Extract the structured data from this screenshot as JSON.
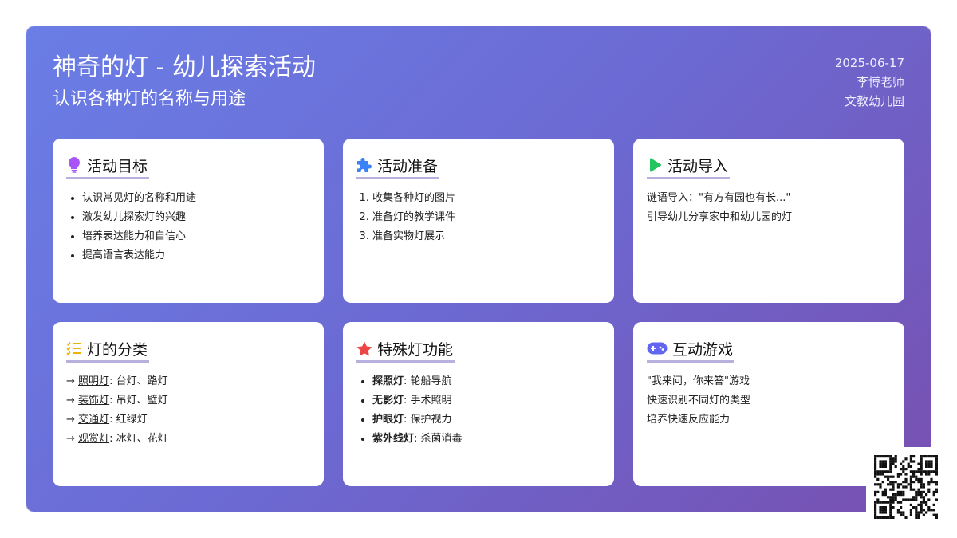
{
  "header": {
    "title": "神奇的灯 - 幼儿探索活动",
    "subtitle": "认识各种灯的名称与用途",
    "date": "2025-06-17",
    "teacher": "李博老师",
    "school": "文教幼儿园"
  },
  "cards": {
    "goals": {
      "title": "活动目标",
      "icon": "lightbulb-icon",
      "items": [
        "认识常见灯的名称和用途",
        "激发幼儿探索灯的兴趣",
        "培养表达能力和自信心",
        "提高语言表达能力"
      ]
    },
    "prep": {
      "title": "活动准备",
      "icon": "puzzle-icon",
      "items": [
        "收集各种灯的图片",
        "准备灯的教学课件",
        "准备实物灯展示"
      ]
    },
    "intro": {
      "title": "活动导入",
      "icon": "play-icon",
      "lines": [
        "谜语导入：\"有方有园也有长...\"",
        "引导幼儿分享家中和幼儿园的灯"
      ]
    },
    "categories": {
      "title": "灯的分类",
      "icon": "checklist-icon",
      "items": [
        {
          "arrow": "→",
          "name": "照明灯",
          "examples": ": 台灯、路灯"
        },
        {
          "arrow": "→",
          "name": "装饰灯",
          "examples": ": 吊灯、壁灯"
        },
        {
          "arrow": "→",
          "name": "交通灯",
          "examples": ": 红绿灯"
        },
        {
          "arrow": "→",
          "name": "观赏灯",
          "examples": ": 冰灯、花灯"
        }
      ]
    },
    "special": {
      "title": "特殊灯功能",
      "icon": "star-icon",
      "items": [
        {
          "name": "探照灯",
          "desc": ": 轮船导航"
        },
        {
          "name": "无影灯",
          "desc": ": 手术照明"
        },
        {
          "name": "护眼灯",
          "desc": ": 保护视力"
        },
        {
          "name": "紫外线灯",
          "desc": ": 杀菌消毒"
        }
      ]
    },
    "game": {
      "title": "互动游戏",
      "icon": "gamepad-icon",
      "lines": [
        "\"我来问，你来答\"游戏",
        "快速识别不同灯的类型",
        "培养快速反应能力"
      ]
    }
  },
  "colors": {
    "gradient_start": "#6a7ee6",
    "gradient_end": "#7750b0",
    "heading_underline": "#b9b0dd",
    "bulb": "#a855f7",
    "puzzle": "#3b82f6",
    "play": "#22c55e",
    "checklist": "#eab308",
    "star": "#ef4444",
    "gamepad": "#6366f1"
  },
  "qr_icon": "qr-code-icon"
}
